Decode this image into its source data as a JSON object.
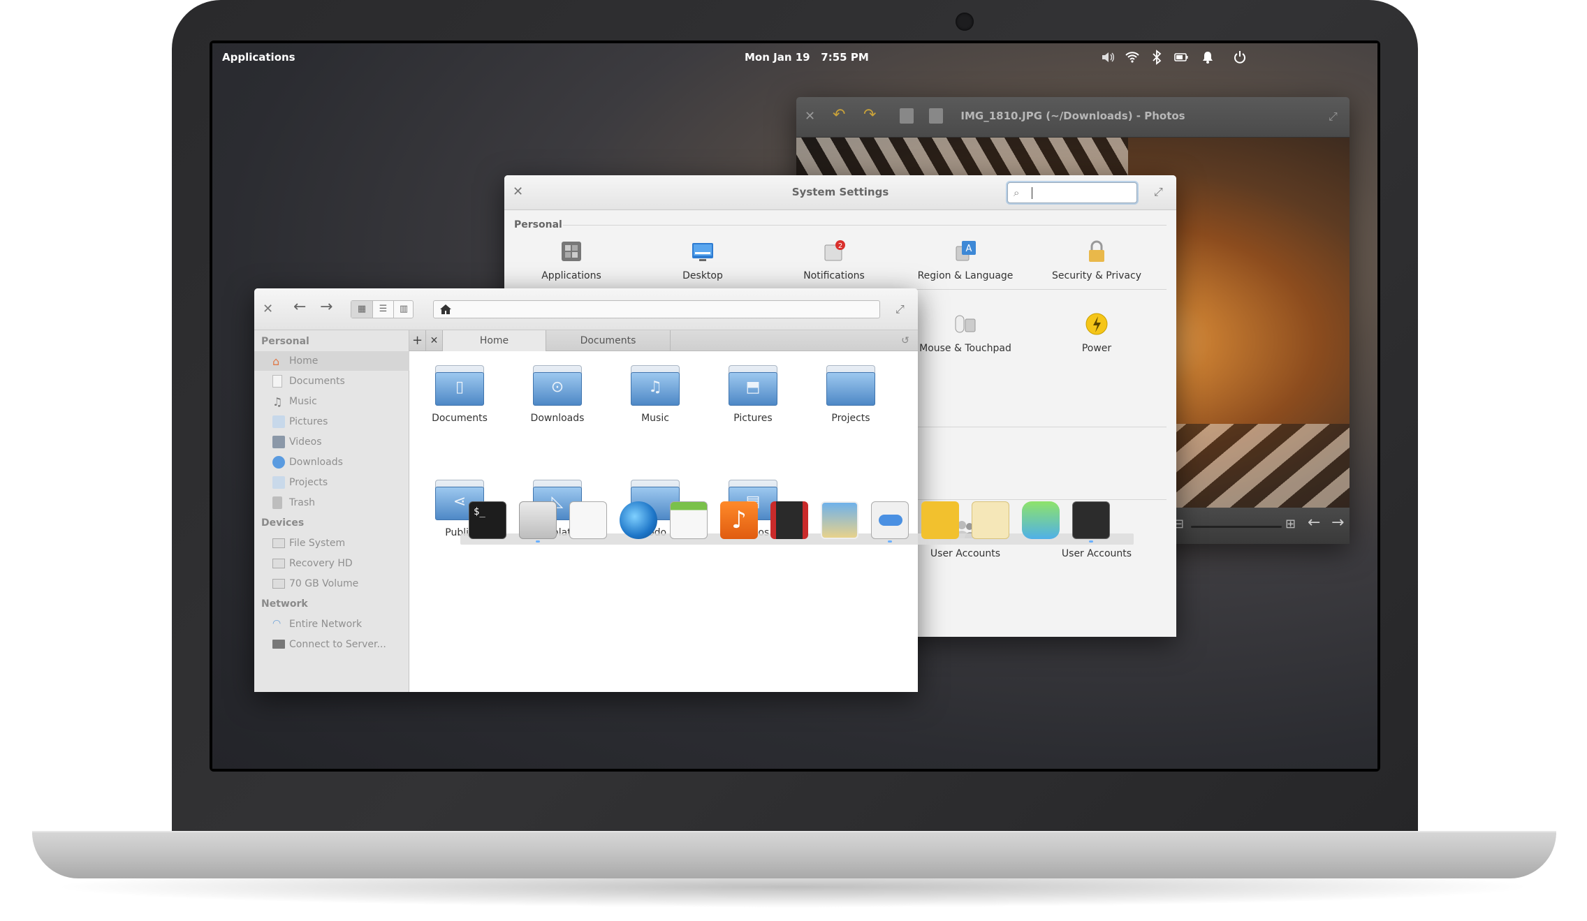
{
  "panel": {
    "applications_label": "Applications",
    "date": "Mon Jan 19",
    "time": "7:55 PM",
    "indicators": [
      "volume-icon",
      "wifi-icon",
      "bluetooth-icon",
      "battery-icon",
      "notifications-icon",
      "power-icon"
    ]
  },
  "photos": {
    "title": "IMG_1810.JPG (~/Downloads) - Photos"
  },
  "settings": {
    "title": "System Settings",
    "search_placeholder": "",
    "section_personal": "Personal",
    "personal_items": [
      "Applications",
      "Desktop",
      "Notifications",
      "Region & Language",
      "Security & Privacy"
    ],
    "notifications_badge": "2",
    "hardware_items": [
      "Mouse & Touchpad",
      "Power"
    ],
    "system_items": [
      "User Accounts",
      "User Accounts"
    ]
  },
  "files": {
    "sidebar": {
      "personal_header": "Personal",
      "personal": [
        "Home",
        "Documents",
        "Music",
        "Pictures",
        "Videos",
        "Downloads",
        "Projects",
        "Trash"
      ],
      "devices_header": "Devices",
      "devices": [
        "File System",
        "Recovery HD",
        "70 GB Volume"
      ],
      "network_header": "Network",
      "network": [
        "Entire Network",
        "Connect to Server..."
      ]
    },
    "tabs": [
      "Home",
      "Documents"
    ],
    "folders": [
      "Documents",
      "Downloads",
      "Music",
      "Pictures",
      "Projects",
      "Public",
      "Templates",
      "Todo",
      "Videos"
    ]
  },
  "dock": {
    "apps": [
      "terminal-icon",
      "files-icon",
      "text-editor-icon",
      "web-browser-icon",
      "calendar-icon",
      "music-icon",
      "videos-icon",
      "photos-icon",
      "switchboard-icon",
      "taxi-icon",
      "mail-icon",
      "messaging-icon",
      "screenshot-icon"
    ]
  },
  "colors": {
    "accent_blue": "#4e88c6",
    "panel_text": "#ffffff",
    "notification_badge": "#d9302c",
    "power_yellow": "#f5c518"
  }
}
